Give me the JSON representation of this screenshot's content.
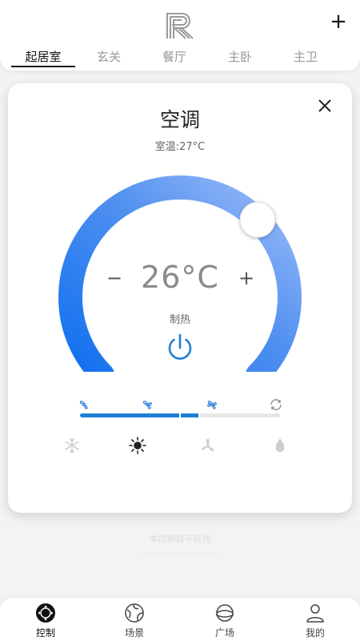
{
  "header": {
    "logo_icon": "r-logo-icon",
    "add_label": "+"
  },
  "tabs": [
    {
      "label": "起居室",
      "active": true
    },
    {
      "label": "玄关",
      "active": false
    },
    {
      "label": "餐厅",
      "active": false
    },
    {
      "label": "主卧",
      "active": false
    },
    {
      "label": "主卫",
      "active": false
    }
  ],
  "device": {
    "title": "空调",
    "room_temp": "室温:27°C",
    "set_temp": "26°C",
    "minus_label": "−",
    "plus_label": "+",
    "mode": "制热",
    "dial_fraction": 0.78,
    "power_icon": "power-icon"
  },
  "fan": {
    "levels": 4,
    "current_level": 2,
    "icons": [
      "fan-low-icon",
      "fan-mid-icon",
      "fan-high-icon",
      "fan-auto-icon"
    ]
  },
  "modes": {
    "icons": [
      "snowflake-icon",
      "sun-icon",
      "fan-icon",
      "drop-icon"
    ],
    "selected": 1
  },
  "hint": "本控制器不在线",
  "nav": [
    {
      "label": "控制",
      "icon": "control-icon",
      "active": true
    },
    {
      "label": "场景",
      "icon": "scene-icon",
      "active": false
    },
    {
      "label": "广场",
      "icon": "plaza-icon",
      "active": false
    },
    {
      "label": "我的",
      "icon": "profile-icon",
      "active": false
    }
  ],
  "colors": {
    "accent": "#1d7ed6",
    "arc_start": "#1e7df2",
    "arc_end": "#8fb4f7"
  }
}
